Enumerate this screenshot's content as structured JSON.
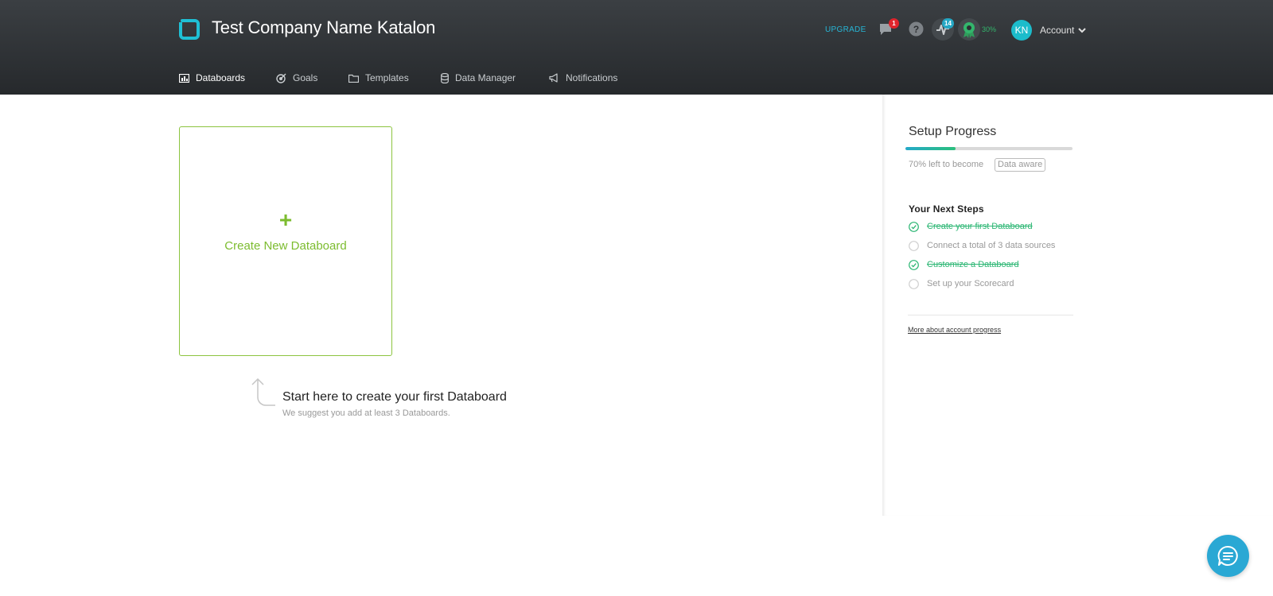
{
  "header": {
    "company_name": "Test Company Name Katalon",
    "upgrade_label": "UPGRADE",
    "messages_badge": "1",
    "activity_badge": "14",
    "award_percent": "30%",
    "avatar_initials": "KN",
    "account_label": "Account"
  },
  "nav": {
    "items": [
      {
        "label": "Databoards",
        "icon": "chart-icon",
        "active": true
      },
      {
        "label": "Goals",
        "icon": "target-icon"
      },
      {
        "label": "Templates",
        "icon": "folder-icon"
      },
      {
        "label": "Data Manager",
        "icon": "database-icon"
      },
      {
        "label": "Notifications",
        "icon": "megaphone-icon"
      }
    ]
  },
  "main": {
    "create_plus": "+",
    "create_label": "Create New Databoard",
    "start_title": "Start here to create your first Databoard",
    "start_subtitle": "We suggest you add at least 3 Databoards."
  },
  "sidebar": {
    "title": "Setup Progress",
    "progress_fraction": 0.3,
    "left_text": "70% left to become",
    "level_tag": "Data aware",
    "steps_title": "Your Next Steps",
    "steps": [
      {
        "label": "Create your first Databoard",
        "done": true
      },
      {
        "label": "Connect a total of 3 data sources",
        "done": false
      },
      {
        "label": "Customize a Databoard",
        "done": true
      },
      {
        "label": "Set up your Scorecard",
        "done": false
      }
    ],
    "more_link": "More about account progress"
  },
  "colors": {
    "header_bg": "#2c2f32",
    "accent_cyan": "#27b6d6",
    "green": "#7cbc2f",
    "done_green": "#2bb673",
    "badge_red": "#e0242c"
  }
}
